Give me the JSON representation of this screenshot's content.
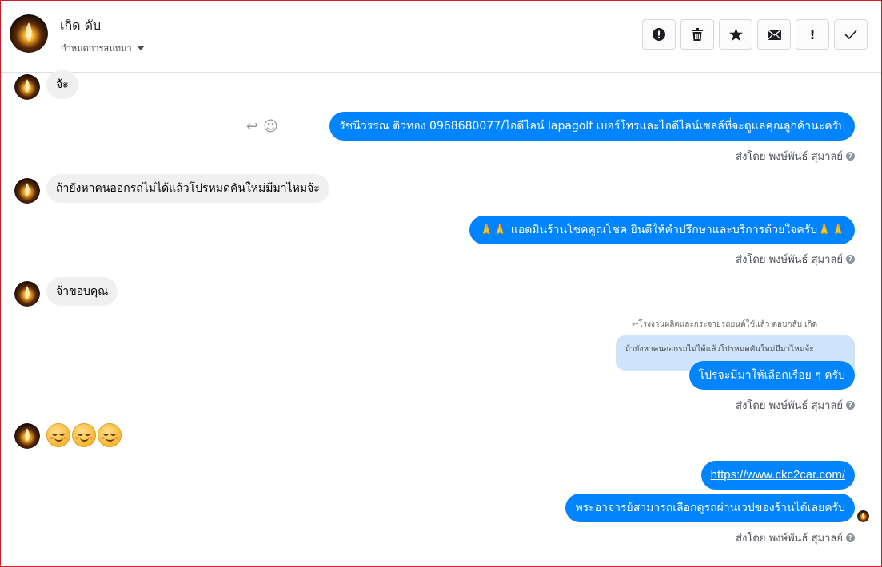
{
  "header": {
    "contact_name": "เกิด ดับ",
    "assign_label": "กำหนดการสนทนา",
    "actions": [
      {
        "icon": "alert-circle-icon",
        "glyph": "!"
      },
      {
        "icon": "trash-icon",
        "glyph": "🗑"
      },
      {
        "icon": "star-icon",
        "glyph": "★"
      },
      {
        "icon": "mail-icon",
        "glyph": "✉"
      },
      {
        "icon": "exclamation-icon",
        "glyph": "!"
      },
      {
        "icon": "check-icon",
        "glyph": "✓"
      }
    ]
  },
  "messages": [
    {
      "dir": "in",
      "text": "จ้ะ"
    },
    {
      "dir": "out",
      "text": "รัชนีวรรณ ติวทอง   0968680077/ไอดีไลน์ lapagolf  เบอร์โทรและไอดีไลน์เซลล์ที่จะดูแลคุณลูกค้านะครับ",
      "sent_by": "ส่งโดย พงษ์พันธ์ สุมาลย์"
    },
    {
      "dir": "in",
      "text": "ถ้ายังหาคนออกรถไม่ได้แล้วโปรหมดคันใหม่มีมาไหมจ้ะ"
    },
    {
      "dir": "out",
      "text": "🙏🙏 แอดมินร้านโชคคูณโชค ยินดีให้คำปรึกษาและบริการด้วยใจครับ🙏🙏",
      "sent_by": "ส่งโดย พงษ์พันธ์ สุมาลย์"
    },
    {
      "dir": "in",
      "text": "จ้าขอบคุณ"
    },
    {
      "dir": "out",
      "reply_label": "↩โรงงานผลิตและกระจายรถยนต์ใช้แล้ว ตอบกลับ เกิด",
      "quoted": "ถ้ายังหาคนออกรถไม่ได้แล้วโปรหมดคันใหม่มีมาไหมจ้ะ",
      "text": "โปรจะมีมาให้เลือกเรื่อย ๆ ครับ",
      "sent_by": "ส่งโดย พงษ์พันธ์ สุมาลย์"
    },
    {
      "dir": "in",
      "emoji": "☺☺☺"
    },
    {
      "dir": "out",
      "link": "https://www.ckc2car.com/",
      "text": "พระอาจารย์สามารถเลือกดูรถผ่านเวปของร้านได้เลยครับ",
      "sent_by": "ส่งโดย พงษ์พันธ์ สุมาลย์"
    }
  ],
  "colors": {
    "outgoing_bubble": "#0084ff",
    "incoming_bubble": "#f0f0f0",
    "quoted_bubble": "#cfe4fa",
    "border_accent": "#c8202a"
  }
}
